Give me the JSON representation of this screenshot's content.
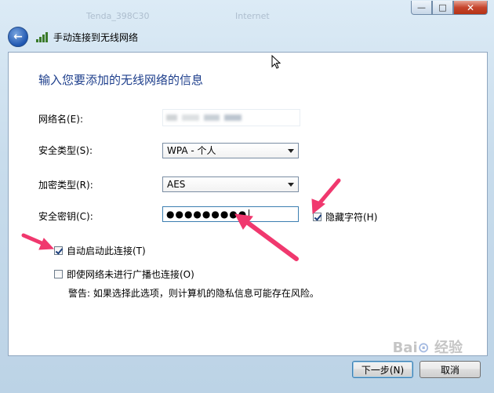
{
  "window": {
    "blurred_title_left": "Tenda_398C30",
    "blurred_title_right": "Internet",
    "controls": {
      "minimize": "—",
      "maximize": "□",
      "close": "✕"
    }
  },
  "nav": {
    "title": "手动连接到无线网络",
    "back_icon": "back-arrow-icon"
  },
  "form": {
    "heading": "输入您要添加的无线网络的信息",
    "network_name_label": "网络名(E):",
    "security_type_label": "安全类型(S):",
    "security_type_value": "WPA - 个人",
    "encryption_type_label": "加密类型(R):",
    "encryption_type_value": "AES",
    "security_key_label": "安全密钥(C):",
    "security_key_value": "●●●●●●●●●",
    "hide_chars_label": "隐藏字符(H)",
    "hide_chars_checked": true,
    "auto_start_label": "自动启动此连接(T)",
    "auto_start_checked": true,
    "connect_hidden_label": "即使网络未进行广播也连接(O)",
    "connect_hidden_checked": false,
    "warning": "警告: 如果选择此选项，则计算机的隐私信息可能存在风险。"
  },
  "buttons": {
    "next": "下一步(N)",
    "cancel": "取消"
  },
  "watermark": "Baidu 经验",
  "colors": {
    "heading": "#1e3f8c",
    "annotation_arrow": "#f0386e"
  }
}
